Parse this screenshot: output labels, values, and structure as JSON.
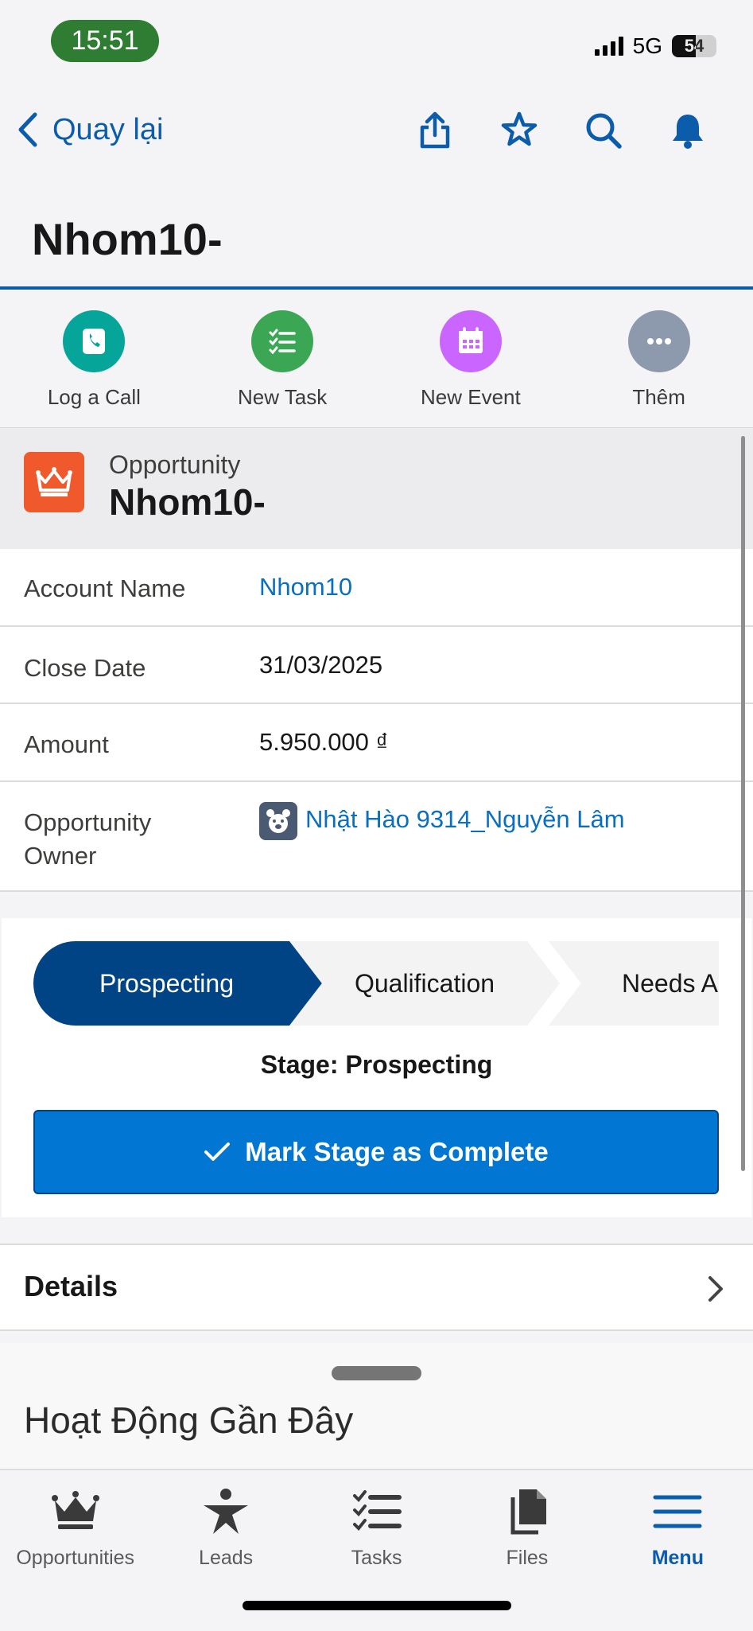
{
  "status_bar": {
    "time": "15:51",
    "network": "5G",
    "battery": "54"
  },
  "nav": {
    "back_label": "Quay lại"
  },
  "page_title": "Nhom10-",
  "quick_actions": [
    {
      "label": "Log a Call",
      "icon": "phone-icon",
      "color": "#06a59a"
    },
    {
      "label": "New Task",
      "icon": "task-icon",
      "color": "#3ba755"
    },
    {
      "label": "New Event",
      "icon": "calendar-icon",
      "color": "#cb65ff"
    },
    {
      "label": "Thêm",
      "icon": "more-icon",
      "color": "#8d9aad"
    }
  ],
  "record": {
    "type": "Opportunity",
    "name": "Nhom10-",
    "icon": "crown-icon",
    "icon_color": "#f0592b"
  },
  "fields": [
    {
      "label": "Account Name",
      "value": "Nhom10"
    },
    {
      "label": "Close Date",
      "value": "31/03/2025"
    },
    {
      "label": "Amount",
      "value": "5.950.000 ₫"
    },
    {
      "label": "Opportunity Owner",
      "label_line1": "Opportunity",
      "label_line2": "Owner",
      "value": "Nhật Hào 9314_Nguyễn Lâm"
    }
  ],
  "path": {
    "stages": [
      "Prospecting",
      "Qualification",
      "Needs Ana"
    ],
    "current_stage_text": "Stage: Prospecting",
    "mark_complete_label": "Mark Stage as Complete"
  },
  "details_label": "Details",
  "activity_title": "Hoạt Động Gần Đây",
  "tabs": [
    {
      "label": "Opportunities",
      "icon": "crown-icon"
    },
    {
      "label": "Leads",
      "icon": "person-star-icon"
    },
    {
      "label": "Tasks",
      "icon": "task-list-icon"
    },
    {
      "label": "Files",
      "icon": "files-icon"
    },
    {
      "label": "Menu",
      "icon": "hamburger-icon",
      "active": true
    }
  ],
  "colors": {
    "brand_blue": "#0b5cab",
    "active_stage": "#014486",
    "button_blue": "#0176d3"
  }
}
